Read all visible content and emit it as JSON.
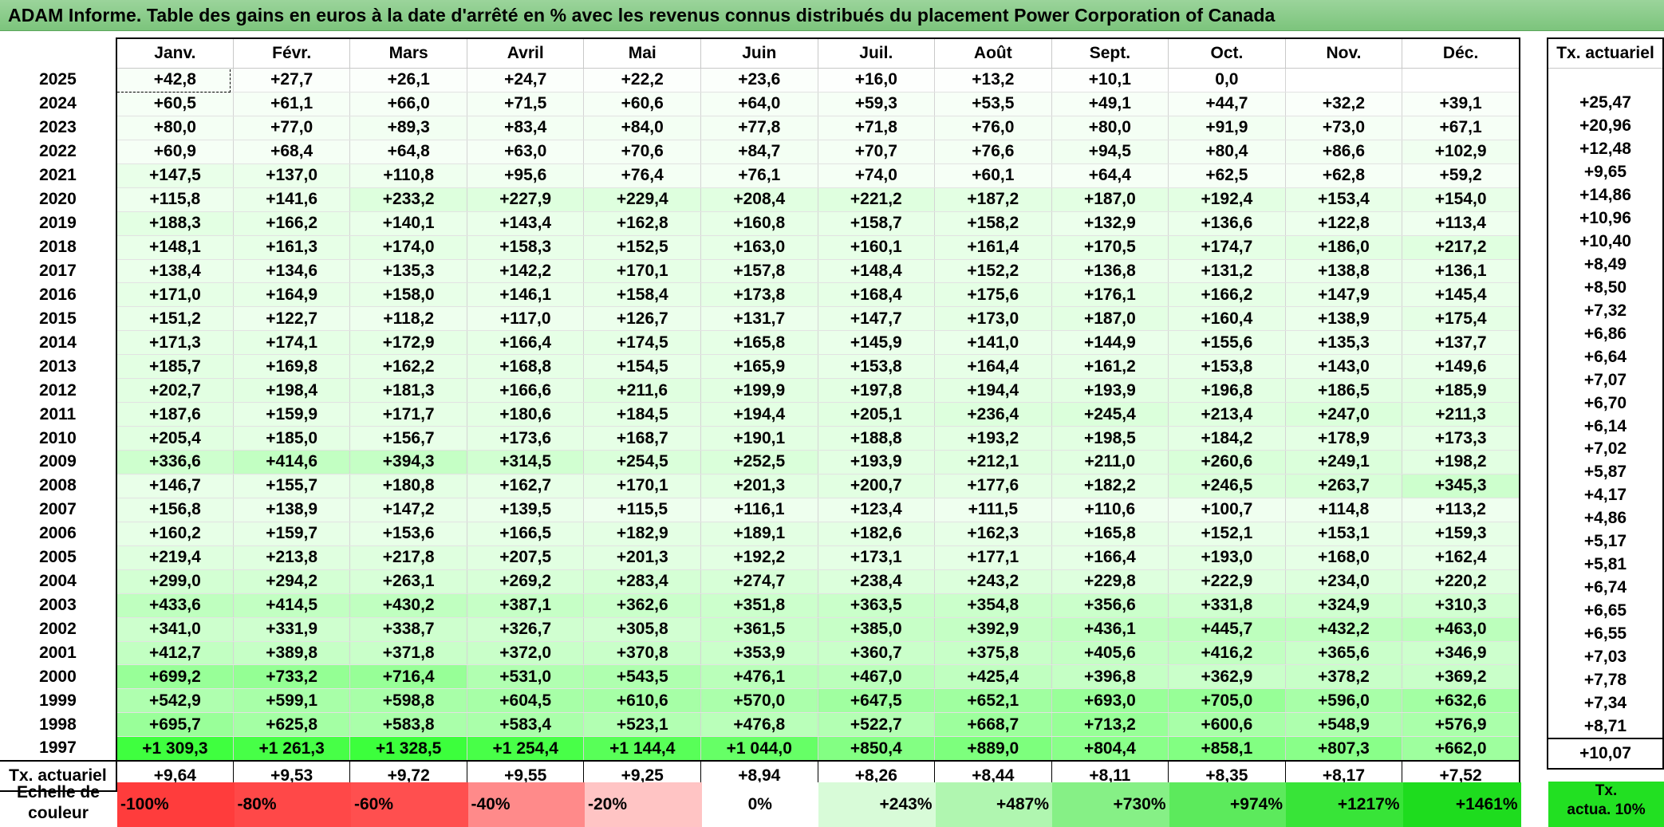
{
  "title": "ADAM Informe. Table des gains en euros à la date d'arrêté en % avec les revenus connus distribués du placement Power Corporation of Canada",
  "months": [
    "Janv.",
    "Févr.",
    "Mars",
    "Avril",
    "Mai",
    "Juin",
    "Juil.",
    "Août",
    "Sept.",
    "Oct.",
    "Nov.",
    "Déc."
  ],
  "actu_header": "Tx. actuariel",
  "rows": [
    {
      "year": "2025",
      "values": [
        "+42,8",
        "+27,7",
        "+26,1",
        "+24,7",
        "+22,2",
        "+23,6",
        "+16,0",
        "+13,2",
        "+10,1",
        "0,0",
        "",
        ""
      ],
      "actu": ""
    },
    {
      "year": "2024",
      "values": [
        "+60,5",
        "+61,1",
        "+66,0",
        "+71,5",
        "+60,6",
        "+64,0",
        "+59,3",
        "+53,5",
        "+49,1",
        "+44,7",
        "+32,2",
        "+39,1"
      ],
      "actu": "+25,47"
    },
    {
      "year": "2023",
      "values": [
        "+80,0",
        "+77,0",
        "+89,3",
        "+83,4",
        "+84,0",
        "+77,8",
        "+71,8",
        "+76,0",
        "+80,0",
        "+91,9",
        "+73,0",
        "+67,1"
      ],
      "actu": "+20,96"
    },
    {
      "year": "2022",
      "values": [
        "+60,9",
        "+68,4",
        "+64,8",
        "+63,0",
        "+70,6",
        "+84,7",
        "+70,7",
        "+76,6",
        "+94,5",
        "+80,4",
        "+86,6",
        "+102,9"
      ],
      "actu": "+12,48"
    },
    {
      "year": "2021",
      "values": [
        "+147,5",
        "+137,0",
        "+110,8",
        "+95,6",
        "+76,4",
        "+76,1",
        "+74,0",
        "+60,1",
        "+64,4",
        "+62,5",
        "+62,8",
        "+59,2"
      ],
      "actu": "+9,65"
    },
    {
      "year": "2020",
      "values": [
        "+115,8",
        "+141,6",
        "+233,2",
        "+227,9",
        "+229,4",
        "+208,4",
        "+221,2",
        "+187,2",
        "+187,0",
        "+192,4",
        "+153,4",
        "+154,0"
      ],
      "actu": "+14,86"
    },
    {
      "year": "2019",
      "values": [
        "+188,3",
        "+166,2",
        "+140,1",
        "+143,4",
        "+162,8",
        "+160,8",
        "+158,7",
        "+158,2",
        "+132,9",
        "+136,6",
        "+122,8",
        "+113,4"
      ],
      "actu": "+10,96"
    },
    {
      "year": "2018",
      "values": [
        "+148,1",
        "+161,3",
        "+174,0",
        "+158,3",
        "+152,5",
        "+163,0",
        "+160,1",
        "+161,4",
        "+170,5",
        "+174,7",
        "+186,0",
        "+217,2"
      ],
      "actu": "+10,40"
    },
    {
      "year": "2017",
      "values": [
        "+138,4",
        "+134,6",
        "+135,3",
        "+142,2",
        "+170,1",
        "+157,8",
        "+148,4",
        "+152,2",
        "+136,8",
        "+131,2",
        "+138,8",
        "+136,1"
      ],
      "actu": "+8,49"
    },
    {
      "year": "2016",
      "values": [
        "+171,0",
        "+164,9",
        "+158,0",
        "+146,1",
        "+158,4",
        "+173,8",
        "+168,4",
        "+175,6",
        "+176,1",
        "+166,2",
        "+147,9",
        "+145,4"
      ],
      "actu": "+8,50"
    },
    {
      "year": "2015",
      "values": [
        "+151,2",
        "+122,7",
        "+118,2",
        "+117,0",
        "+126,7",
        "+131,7",
        "+147,7",
        "+173,0",
        "+187,0",
        "+160,4",
        "+138,9",
        "+175,4"
      ],
      "actu": "+7,32"
    },
    {
      "year": "2014",
      "values": [
        "+171,3",
        "+174,1",
        "+172,9",
        "+166,4",
        "+174,5",
        "+165,8",
        "+145,9",
        "+141,0",
        "+144,9",
        "+155,6",
        "+135,3",
        "+137,7"
      ],
      "actu": "+6,86"
    },
    {
      "year": "2013",
      "values": [
        "+185,7",
        "+169,8",
        "+162,2",
        "+168,8",
        "+154,5",
        "+165,9",
        "+153,8",
        "+164,4",
        "+161,2",
        "+153,8",
        "+143,0",
        "+149,6"
      ],
      "actu": "+6,64"
    },
    {
      "year": "2012",
      "values": [
        "+202,7",
        "+198,4",
        "+181,3",
        "+166,6",
        "+211,6",
        "+199,9",
        "+197,8",
        "+194,4",
        "+193,9",
        "+196,8",
        "+186,5",
        "+185,9"
      ],
      "actu": "+7,07"
    },
    {
      "year": "2011",
      "values": [
        "+187,6",
        "+159,9",
        "+171,7",
        "+180,6",
        "+184,5",
        "+194,4",
        "+205,1",
        "+236,4",
        "+245,4",
        "+213,4",
        "+247,0",
        "+211,3"
      ],
      "actu": "+6,70"
    },
    {
      "year": "2010",
      "values": [
        "+205,4",
        "+185,0",
        "+156,7",
        "+173,6",
        "+168,7",
        "+190,1",
        "+188,8",
        "+193,2",
        "+198,5",
        "+184,2",
        "+178,9",
        "+173,3"
      ],
      "actu": "+6,14"
    },
    {
      "year": "2009",
      "values": [
        "+336,6",
        "+414,6",
        "+394,3",
        "+314,5",
        "+254,5",
        "+252,5",
        "+193,9",
        "+212,1",
        "+211,0",
        "+260,6",
        "+249,1",
        "+198,2"
      ],
      "actu": "+7,02"
    },
    {
      "year": "2008",
      "values": [
        "+146,7",
        "+155,7",
        "+180,8",
        "+162,7",
        "+170,1",
        "+201,3",
        "+200,7",
        "+177,6",
        "+182,2",
        "+246,5",
        "+263,7",
        "+345,3"
      ],
      "actu": "+5,87"
    },
    {
      "year": "2007",
      "values": [
        "+156,8",
        "+138,9",
        "+147,2",
        "+139,5",
        "+115,5",
        "+116,1",
        "+123,4",
        "+111,5",
        "+110,6",
        "+100,7",
        "+114,8",
        "+113,2"
      ],
      "actu": "+4,17"
    },
    {
      "year": "2006",
      "values": [
        "+160,2",
        "+159,7",
        "+153,6",
        "+166,5",
        "+182,9",
        "+189,1",
        "+182,6",
        "+162,3",
        "+165,8",
        "+152,1",
        "+153,1",
        "+159,3"
      ],
      "actu": "+4,86"
    },
    {
      "year": "2005",
      "values": [
        "+219,4",
        "+213,8",
        "+217,8",
        "+207,5",
        "+201,3",
        "+192,2",
        "+173,1",
        "+177,1",
        "+166,4",
        "+193,0",
        "+168,0",
        "+162,4"
      ],
      "actu": "+5,17"
    },
    {
      "year": "2004",
      "values": [
        "+299,0",
        "+294,2",
        "+263,1",
        "+269,2",
        "+283,4",
        "+274,7",
        "+238,4",
        "+243,2",
        "+229,8",
        "+222,9",
        "+234,0",
        "+220,2"
      ],
      "actu": "+5,81"
    },
    {
      "year": "2003",
      "values": [
        "+433,6",
        "+414,5",
        "+430,2",
        "+387,1",
        "+362,6",
        "+351,8",
        "+363,5",
        "+354,8",
        "+356,6",
        "+331,8",
        "+324,9",
        "+310,3"
      ],
      "actu": "+6,74"
    },
    {
      "year": "2002",
      "values": [
        "+341,0",
        "+331,9",
        "+338,7",
        "+326,7",
        "+305,8",
        "+361,5",
        "+385,0",
        "+392,9",
        "+436,1",
        "+445,7",
        "+432,2",
        "+463,0"
      ],
      "actu": "+6,65"
    },
    {
      "year": "2001",
      "values": [
        "+412,7",
        "+389,8",
        "+371,8",
        "+372,0",
        "+370,8",
        "+353,9",
        "+360,7",
        "+375,8",
        "+405,6",
        "+416,2",
        "+365,6",
        "+346,9"
      ],
      "actu": "+6,55"
    },
    {
      "year": "2000",
      "values": [
        "+699,2",
        "+733,2",
        "+716,4",
        "+531,0",
        "+543,5",
        "+476,1",
        "+467,0",
        "+425,4",
        "+396,8",
        "+362,9",
        "+378,2",
        "+369,2"
      ],
      "actu": "+7,03"
    },
    {
      "year": "1999",
      "values": [
        "+542,9",
        "+599,1",
        "+598,8",
        "+604,5",
        "+610,6",
        "+570,0",
        "+647,5",
        "+652,1",
        "+693,0",
        "+705,0",
        "+596,0",
        "+632,6"
      ],
      "actu": "+7,78"
    },
    {
      "year": "1998",
      "values": [
        "+695,7",
        "+625,8",
        "+583,8",
        "+583,4",
        "+523,1",
        "+476,8",
        "+522,7",
        "+668,7",
        "+713,2",
        "+600,6",
        "+548,9",
        "+576,9"
      ],
      "actu": "+7,34"
    },
    {
      "year": "1997",
      "values": [
        "+1 309,3",
        "+1 261,3",
        "+1 328,5",
        "+1 254,4",
        "+1 144,4",
        "+1 044,0",
        "+850,4",
        "+889,0",
        "+804,4",
        "+858,1",
        "+807,3",
        "+662,0"
      ],
      "actu": "+8,71"
    }
  ],
  "footer": {
    "label": "Tx. actuariel",
    "values": [
      "+9,64",
      "+9,53",
      "+9,72",
      "+9,55",
      "+9,25",
      "+8,94",
      "+8,26",
      "+8,44",
      "+8,11",
      "+8,35",
      "+8,17",
      "+7,52"
    ],
    "actu": "+10,07"
  },
  "legend": {
    "label_line1": "Echelle de",
    "label_line2": "couleur",
    "swatches": [
      {
        "label": "-100%",
        "color": "#ff3c3c",
        "kind": "neg"
      },
      {
        "label": "-80%",
        "color": "#ff4848",
        "kind": "neg"
      },
      {
        "label": "-60%",
        "color": "#ff4f4f",
        "kind": "neg"
      },
      {
        "label": "-40%",
        "color": "#ff8a8a",
        "kind": "neg"
      },
      {
        "label": "-20%",
        "color": "#ffc4c4",
        "kind": "neg"
      },
      {
        "label": "0%",
        "color": "#ffffff",
        "kind": "zero"
      },
      {
        "label": "+243%",
        "color": "#d8fbd8",
        "kind": "pos"
      },
      {
        "label": "+487%",
        "color": "#b0f6b0",
        "kind": "pos"
      },
      {
        "label": "+730%",
        "color": "#86f086",
        "kind": "pos"
      },
      {
        "label": "+974%",
        "color": "#5cea5c",
        "kind": "pos"
      },
      {
        "label": "+1217%",
        "color": "#38e438",
        "kind": "pos"
      },
      {
        "label": "+1461%",
        "color": "#1edc1e",
        "kind": "pos"
      }
    ],
    "actu_line1": "Tx.",
    "actu_line2": "actua. 10%",
    "actu_color": "#22e022"
  }
}
